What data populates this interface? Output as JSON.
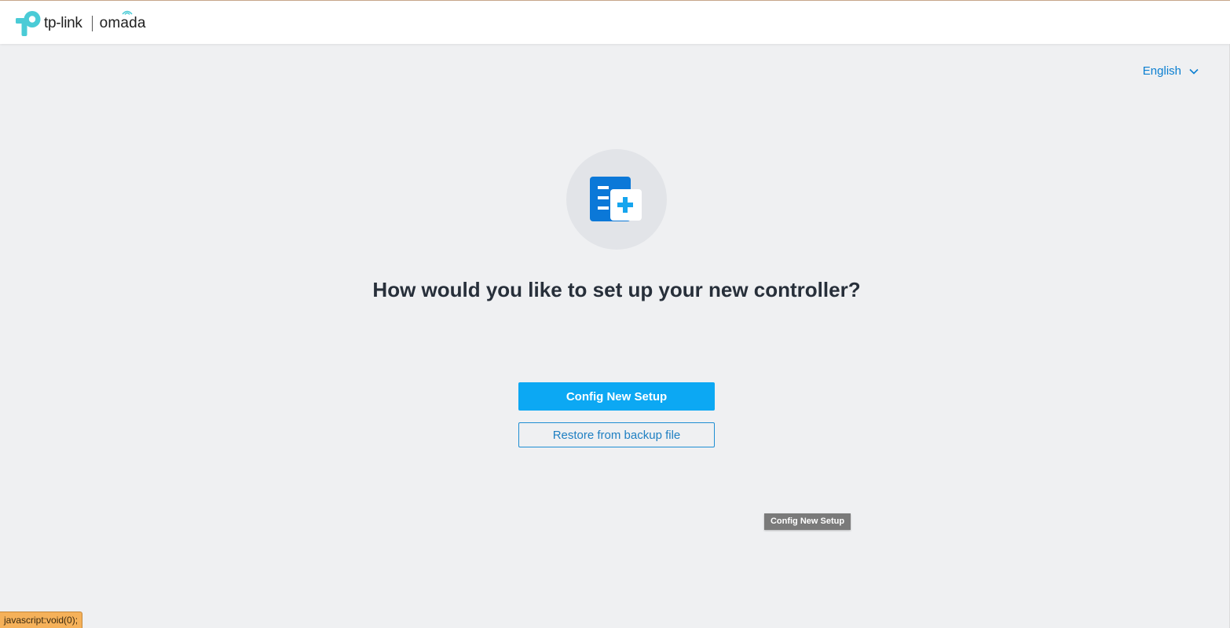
{
  "header": {
    "brand_tplink": "tp-link",
    "brand_omada": "omada",
    "logo_icon": "tp-link-logo-icon"
  },
  "language": {
    "selected": "English",
    "icon": "chevron-down-icon",
    "color": "#0b7fd1"
  },
  "hero": {
    "icon": "new-document-plus-icon",
    "title": "How would you like to set up your new controller?"
  },
  "actions": {
    "primary_label": "Config New Setup",
    "secondary_label": "Restore from backup file",
    "primary_color": "#0ca8f3"
  },
  "tooltip": {
    "text": "Config New Setup"
  },
  "status_bar": {
    "text": "javascript:void(0);"
  },
  "colors": {
    "brand_teal": "#4acbd6",
    "background": "#eff0f2",
    "title_text": "#272f3a"
  }
}
